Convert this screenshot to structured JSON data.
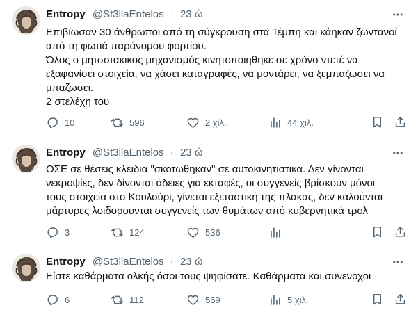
{
  "tweets": [
    {
      "name": "Entropy",
      "handle": "@St3llaEntelos",
      "dot": "·",
      "time": "23 ώ",
      "lines": [
        "Επιβίωσαν 30 άνθρωποι από τη σύγκρουση στα Τέμπη και κάηκαν ζωντανοί",
        "από τη φωτιά παράνομου φορτίου.",
        "Όλος ο μητσοτακικος μηχανισμός κινητοποιηθηκε σε χρόνο ντετέ να",
        "εξαφανίσει στοιχεία, να χάσει καταγραφές, να μοντάρει, να ξεμπαζωσει να",
        "μπαζωσει.",
        "2 στελέχη του"
      ],
      "replies": "10",
      "reposts": "596",
      "likes": "2 χιλ.",
      "views": "44 χιλ."
    },
    {
      "name": "Entropy",
      "handle": "@St3llaEntelos",
      "dot": "·",
      "time": "23 ώ",
      "lines": [
        "ΟΣΕ σε θέσεις κλειδια \"σκοτωθηκαν\" σε αυτοκινητιστικα. Δεν γίνονται",
        "νεκροψίες, δεν δίνονται άδειες για εκταφές, οι συγγενείς βρίσκουν μόνοι",
        "τους στοιχεία στο Κουλούρι, γίνεται εξεταστική της πλακας, δεν καλούνται",
        "μάρτυρες λοιδορουνται συγγενείς των θυμάτων από κυβερνητικά τρολ"
      ],
      "replies": "3",
      "reposts": "124",
      "likes": "536",
      "views": ""
    },
    {
      "name": "Entropy",
      "handle": "@St3llaEntelos",
      "dot": "·",
      "time": "23 ώ",
      "lines": [
        "Είστε καθάρματα ολκής όσοι τους ψηφίσατε. Καθάρματα και συνενοχοι"
      ],
      "replies": "6",
      "reposts": "112",
      "likes": "569",
      "views": "5 χιλ."
    }
  ],
  "icons": {
    "more": "more-dots-icon",
    "reply": "reply-icon",
    "repost": "repost-icon",
    "like": "heart-icon",
    "views": "views-icon",
    "bookmark": "bookmark-icon",
    "share": "share-icon"
  },
  "colors": {
    "text": "#0f1419",
    "muted": "#536471",
    "divider": "#eff3f4"
  }
}
